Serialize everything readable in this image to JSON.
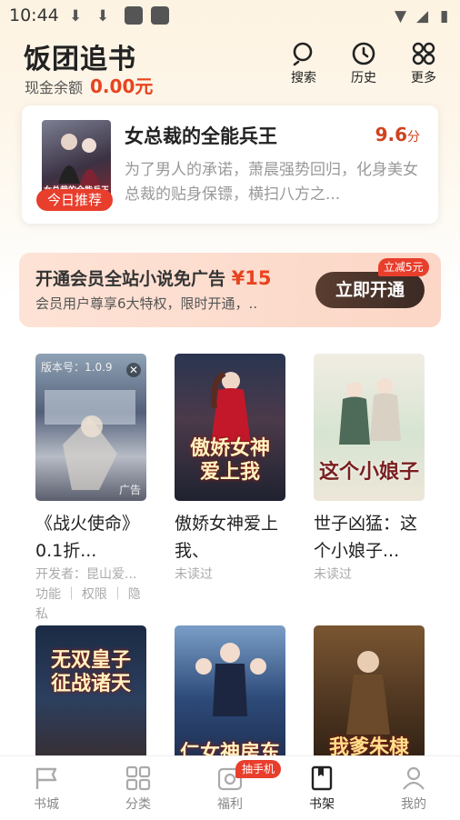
{
  "status_bar": {
    "time": "10:44"
  },
  "header": {
    "title": "饭团追书",
    "cash_label": "现金余额",
    "cash_value": "0.00元",
    "buttons": [
      {
        "label": "搜索",
        "icon": "search-icon"
      },
      {
        "label": "历史",
        "icon": "history-icon"
      },
      {
        "label": "更多",
        "icon": "more-icon"
      }
    ]
  },
  "recommend": {
    "tag": "今日推荐",
    "title": "女总裁的全能兵王",
    "score": "9.6",
    "score_unit": "分",
    "description": "为了男人的承诺，萧晨强势回归，化身美女总裁的贴身保镖，横扫八方之...",
    "cover_text": "女总裁的全能兵王"
  },
  "vip_banner": {
    "title": "开通会员全站小说免广告",
    "price": "¥15",
    "subtitle": "会员用户尊享6大特权，限时开通，..",
    "button": "立即开通",
    "badge": "立减5元"
  },
  "books": [
    {
      "title": "《战火使命》0.1折...",
      "meta1": "开发者：昆山爱...",
      "meta2": "功能 ｜ 权限 ｜ 隐私",
      "ad_label": "版本号：1.0.9",
      "ad_badge": "广告",
      "is_ad": true
    },
    {
      "title": "傲娇女神爱上我、",
      "meta1": "未读过",
      "cover_text": "傲娇女神爱上我"
    },
    {
      "title": "世子凶猛：这个小娘子...",
      "meta1": "未读过",
      "cover_text": "这个小娘子"
    },
    {
      "title": "",
      "cover_text": "无双皇子征战诸天"
    },
    {
      "title": "",
      "cover_text": "仁女神房东"
    },
    {
      "title": "",
      "cover_text": "我爹朱棣"
    }
  ],
  "nav": [
    {
      "label": "书城",
      "icon": "bookstore-icon"
    },
    {
      "label": "分类",
      "icon": "category-icon"
    },
    {
      "label": "福利",
      "icon": "welfare-icon",
      "badge": "抽手机"
    },
    {
      "label": "书架",
      "icon": "bookshelf-icon",
      "active": true
    },
    {
      "label": "我的",
      "icon": "profile-icon"
    }
  ]
}
